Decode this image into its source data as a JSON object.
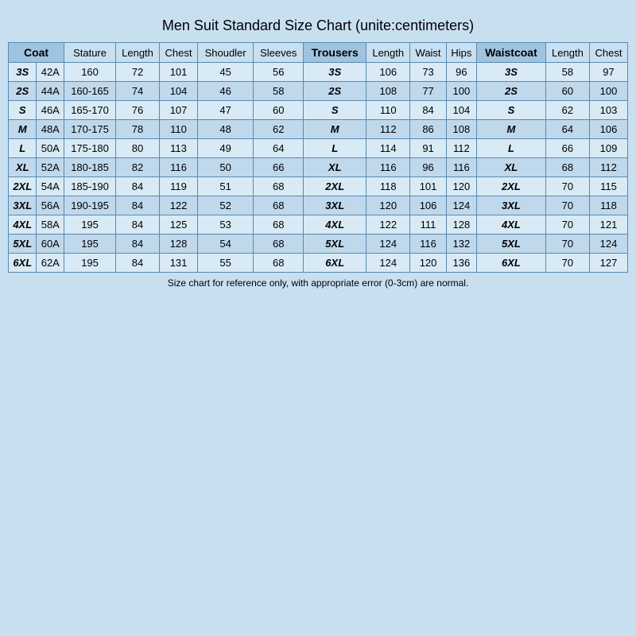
{
  "title": "Men Suit Standard Size Chart   (unite:centimeters)",
  "headers": {
    "coat": "Coat",
    "stature": "Stature",
    "length": "Length",
    "chest": "Chest",
    "shoulder": "Shoudler",
    "sleeves": "Sleeves",
    "trousers": "Trousers",
    "t_length": "Length",
    "waist": "Waist",
    "hips": "Hips",
    "waistcoat": "Waistcoat",
    "w_length": "Length",
    "w_chest": "Chest"
  },
  "rows": [
    {
      "coat": "3S",
      "coat2": "42A",
      "stature": "160",
      "length": "72",
      "chest": "101",
      "shoulder": "45",
      "sleeves": "56",
      "trousers": "3S",
      "t_length": "106",
      "waist": "73",
      "hips": "96",
      "waistcoat": "3S",
      "w_length": "58",
      "w_chest": "97"
    },
    {
      "coat": "2S",
      "coat2": "44A",
      "stature": "160-165",
      "length": "74",
      "chest": "104",
      "shoulder": "46",
      "sleeves": "58",
      "trousers": "2S",
      "t_length": "108",
      "waist": "77",
      "hips": "100",
      "waistcoat": "2S",
      "w_length": "60",
      "w_chest": "100"
    },
    {
      "coat": "S",
      "coat2": "46A",
      "stature": "165-170",
      "length": "76",
      "chest": "107",
      "shoulder": "47",
      "sleeves": "60",
      "trousers": "S",
      "t_length": "110",
      "waist": "84",
      "hips": "104",
      "waistcoat": "S",
      "w_length": "62",
      "w_chest": "103"
    },
    {
      "coat": "M",
      "coat2": "48A",
      "stature": "170-175",
      "length": "78",
      "chest": "110",
      "shoulder": "48",
      "sleeves": "62",
      "trousers": "M",
      "t_length": "112",
      "waist": "86",
      "hips": "108",
      "waistcoat": "M",
      "w_length": "64",
      "w_chest": "106"
    },
    {
      "coat": "L",
      "coat2": "50A",
      "stature": "175-180",
      "length": "80",
      "chest": "113",
      "shoulder": "49",
      "sleeves": "64",
      "trousers": "L",
      "t_length": "114",
      "waist": "91",
      "hips": "112",
      "waistcoat": "L",
      "w_length": "66",
      "w_chest": "109"
    },
    {
      "coat": "XL",
      "coat2": "52A",
      "stature": "180-185",
      "length": "82",
      "chest": "116",
      "shoulder": "50",
      "sleeves": "66",
      "trousers": "XL",
      "t_length": "116",
      "waist": "96",
      "hips": "116",
      "waistcoat": "XL",
      "w_length": "68",
      "w_chest": "112"
    },
    {
      "coat": "2XL",
      "coat2": "54A",
      "stature": "185-190",
      "length": "84",
      "chest": "119",
      "shoulder": "51",
      "sleeves": "68",
      "trousers": "2XL",
      "t_length": "118",
      "waist": "101",
      "hips": "120",
      "waistcoat": "2XL",
      "w_length": "70",
      "w_chest": "115"
    },
    {
      "coat": "3XL",
      "coat2": "56A",
      "stature": "190-195",
      "length": "84",
      "chest": "122",
      "shoulder": "52",
      "sleeves": "68",
      "trousers": "3XL",
      "t_length": "120",
      "waist": "106",
      "hips": "124",
      "waistcoat": "3XL",
      "w_length": "70",
      "w_chest": "118"
    },
    {
      "coat": "4XL",
      "coat2": "58A",
      "stature": "195",
      "length": "84",
      "chest": "125",
      "shoulder": "53",
      "sleeves": "68",
      "trousers": "4XL",
      "t_length": "122",
      "waist": "111",
      "hips": "128",
      "waistcoat": "4XL",
      "w_length": "70",
      "w_chest": "121"
    },
    {
      "coat": "5XL",
      "coat2": "60A",
      "stature": "195",
      "length": "84",
      "chest": "128",
      "shoulder": "54",
      "sleeves": "68",
      "trousers": "5XL",
      "t_length": "124",
      "waist": "116",
      "hips": "132",
      "waistcoat": "5XL",
      "w_length": "70",
      "w_chest": "124"
    },
    {
      "coat": "6XL",
      "coat2": "62A",
      "stature": "195",
      "length": "84",
      "chest": "131",
      "shoulder": "55",
      "sleeves": "68",
      "trousers": "6XL",
      "t_length": "124",
      "waist": "120",
      "hips": "136",
      "waistcoat": "6XL",
      "w_length": "70",
      "w_chest": "127"
    }
  ],
  "footer": "Size chart for reference only, with appropriate error (0-3cm) are normal."
}
